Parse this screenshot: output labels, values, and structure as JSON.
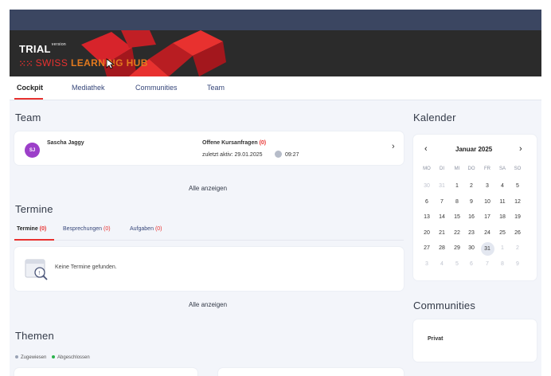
{
  "header": {
    "trial_label": "TRIAL",
    "version_label": "version",
    "brand_swiss": "SWISS",
    "brand_learning": "LEARNING",
    "brand_hub": "HUB",
    "bg_color": "#2b2b2b",
    "accent_color": "#e8312f"
  },
  "tabs": [
    {
      "label": "Cockpit",
      "active": true
    },
    {
      "label": "Mediathek"
    },
    {
      "label": "Communities"
    },
    {
      "label": "Team"
    }
  ],
  "team": {
    "title": "Team",
    "member": {
      "initials": "SJ",
      "name": "Sascha Jaggy",
      "open_requests_label": "Offene Kursanfragen",
      "open_requests_count": "(0)",
      "last_active": "zuletzt aktiv: 29.01.2025",
      "time": "09:27"
    },
    "show_all": "Alle anzeigen"
  },
  "termine": {
    "title": "Termine",
    "subtabs": [
      {
        "label": "Termine",
        "count": "(0)"
      },
      {
        "label": "Besprechungen",
        "count": "(0)"
      },
      {
        "label": "Aufgaben",
        "count": "(0)"
      }
    ],
    "empty_text": "Keine Termine gefunden.",
    "show_all": "Alle anzeigen"
  },
  "themen": {
    "title": "Themen",
    "legend": [
      {
        "label": "Zugewiesen",
        "color": "#9aa3b5"
      },
      {
        "label": "Abgeschlossen",
        "color": "#2bb24c"
      }
    ]
  },
  "calendar": {
    "title": "Kalender",
    "month": "Januar 2025",
    "prev": "‹",
    "next": "›",
    "weekdays": [
      "MO",
      "DI",
      "MI",
      "DO",
      "FR",
      "SA",
      "SO"
    ],
    "weeks": [
      [
        "30",
        "31",
        "1",
        "2",
        "3",
        "4",
        "5"
      ],
      [
        "6",
        "7",
        "8",
        "9",
        "10",
        "11",
        "12"
      ],
      [
        "13",
        "14",
        "15",
        "16",
        "17",
        "18",
        "19"
      ],
      [
        "20",
        "21",
        "22",
        "23",
        "24",
        "25",
        "26"
      ],
      [
        "27",
        "28",
        "29",
        "30",
        "31",
        "1",
        "2"
      ],
      [
        "3",
        "4",
        "5",
        "6",
        "7",
        "8",
        "9"
      ]
    ],
    "today": "31"
  },
  "communities": {
    "title": "Communities",
    "item": "Privat"
  }
}
